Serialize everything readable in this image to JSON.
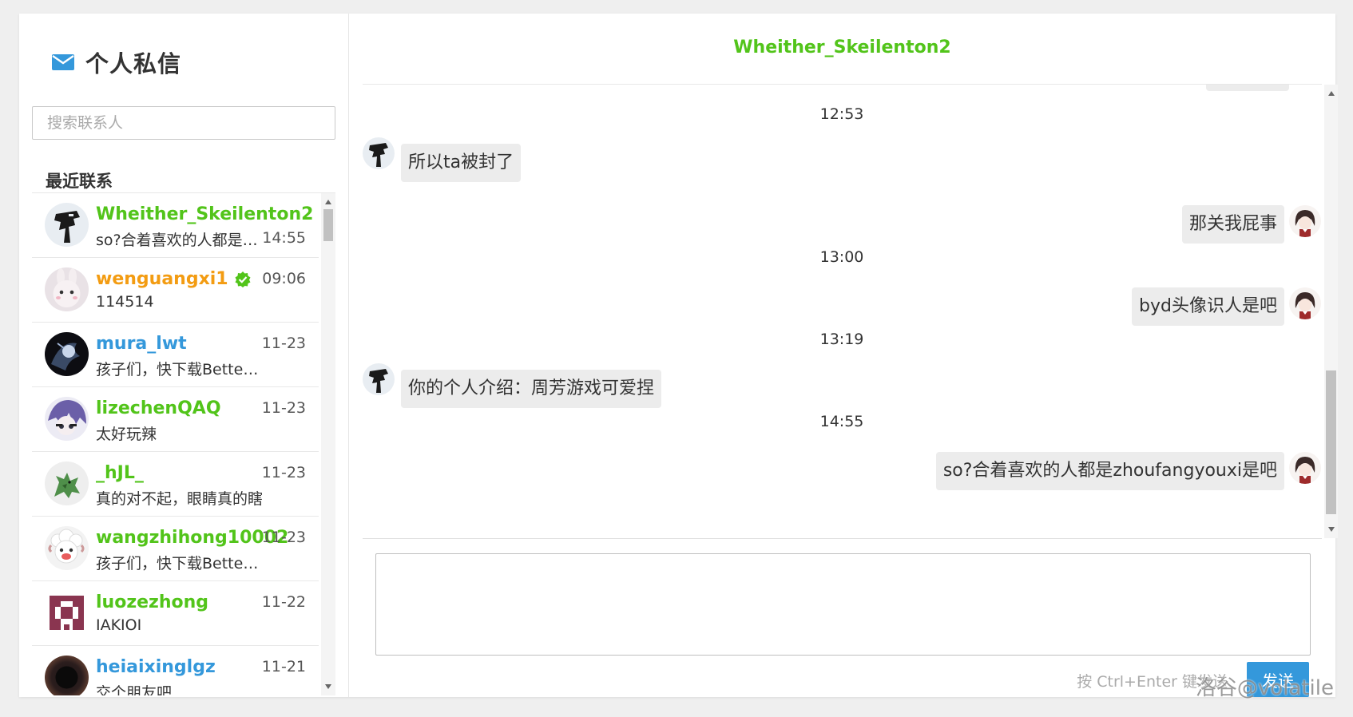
{
  "sidebar": {
    "title": "个人私信",
    "search_placeholder": "搜索联系人",
    "recent_label": "最近联系",
    "contacts": [
      {
        "name": "Wheither_Skeilenton2",
        "name_color": "#52c41a",
        "time": "14:55",
        "preview": "so?合着喜欢的人都是zhoufangyouxi是吧",
        "avatar": "knight-avatar-icon"
      },
      {
        "name": "wenguangxi1",
        "name_color": "#f39c12",
        "time": "09:06",
        "preview": "114514",
        "avatar": "bunny-avatar-icon",
        "verified": true
      },
      {
        "name": "mura_lwt",
        "name_color": "#3498db",
        "time": "11-23",
        "preview": "孩子们，快下载Better Luogu吧",
        "avatar": "dark-character-avatar-icon"
      },
      {
        "name": "lizechenQAQ",
        "name_color": "#52c41a",
        "time": "11-23",
        "preview": "太好玩辣",
        "avatar": "anime-girl-avatar-icon"
      },
      {
        "name": "_hJL_",
        "name_color": "#52c41a",
        "time": "11-23",
        "preview": "真的对不起，眼睛真的瞎",
        "avatar": "dragon-avatar-icon"
      },
      {
        "name": "wangzhihong10002",
        "name_color": "#52c41a",
        "time": "11-23",
        "preview": "孩子们，快下载Better Luogu吧",
        "avatar": "sheep-avatar-icon"
      },
      {
        "name": "luozezhong",
        "name_color": "#52c41a",
        "time": "11-22",
        "preview": "IAKIOI",
        "avatar": "identicon-avatar-icon"
      },
      {
        "name": "heiaixinglgz",
        "name_color": "#3498db",
        "time": "11-21",
        "preview": "交个朋友吧",
        "avatar": "dark-orb-avatar-icon"
      }
    ]
  },
  "chat": {
    "title": "Wheither_Skeilenton2",
    "title_color": "#52c41a",
    "timestamps": [
      "12:53",
      "13:00",
      "13:19",
      "14:55"
    ],
    "messages": [
      {
        "side": "left",
        "text": "所以ta被封了"
      },
      {
        "side": "right",
        "text": "那关我屁事"
      },
      {
        "side": "right",
        "text": "byd头像识人是吧"
      },
      {
        "side": "left",
        "text": "你的个人介绍：周芳游戏可爱捏"
      },
      {
        "side": "right",
        "text": "so?合着喜欢的人都是zhoufangyouxi是吧"
      }
    ],
    "input_value": "",
    "send_hint": "按 Ctrl+Enter 键发送",
    "send_label": "发送"
  },
  "colors": {
    "accent": "#3498db",
    "green_name": "#52c41a",
    "orange_name": "#f39c12"
  },
  "watermark": "洛谷@volatile"
}
